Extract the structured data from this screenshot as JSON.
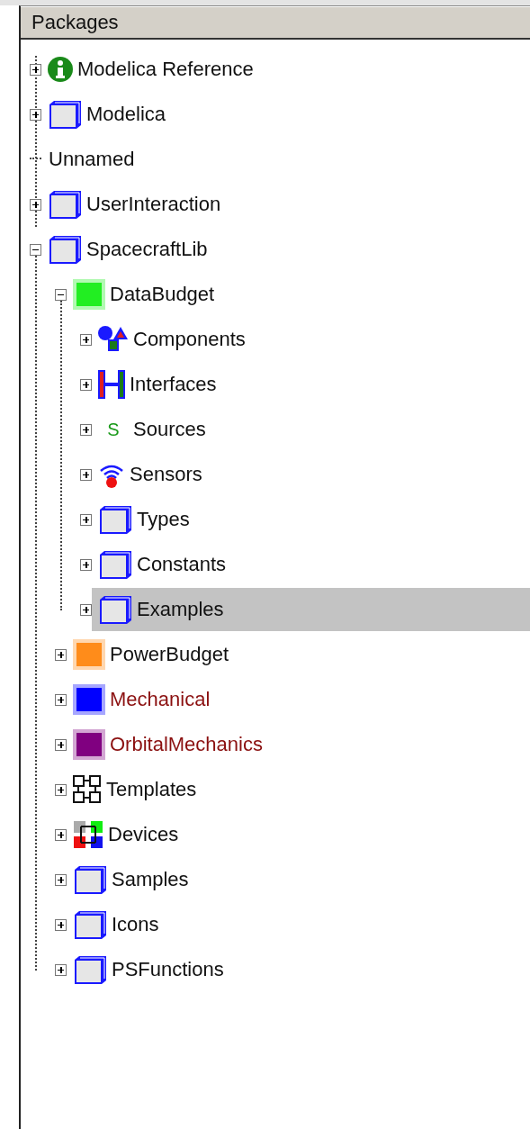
{
  "panel": {
    "title": "Packages"
  },
  "tree": [
    {
      "label": "Modelica Reference",
      "kind": "info",
      "expanded": false,
      "selected": false,
      "marked": false
    },
    {
      "label": "Modelica",
      "kind": "package",
      "expanded": false,
      "selected": false,
      "marked": false
    },
    {
      "label": "Unnamed",
      "kind": "none",
      "selected": false,
      "marked": false
    },
    {
      "label": "UserInteraction",
      "kind": "package",
      "expanded": false,
      "selected": false,
      "marked": false
    },
    {
      "label": "SpacecraftLib",
      "kind": "package",
      "expanded": true,
      "selected": false,
      "marked": false,
      "children": [
        {
          "label": "DataBudget",
          "kind": "square",
          "color": "#22ee22",
          "expanded": true,
          "selected": false,
          "marked": false,
          "children": [
            {
              "label": "Components",
              "kind": "components",
              "expanded": false,
              "selected": false,
              "marked": false
            },
            {
              "label": "Interfaces",
              "kind": "interfaces",
              "expanded": false,
              "selected": false,
              "marked": false
            },
            {
              "label": "Sources",
              "kind": "glyph",
              "glyph": "S",
              "expanded": false,
              "selected": false,
              "marked": false
            },
            {
              "label": "Sensors",
              "kind": "sensor",
              "expanded": false,
              "selected": false,
              "marked": false
            },
            {
              "label": "Types",
              "kind": "package",
              "expanded": false,
              "selected": false,
              "marked": false
            },
            {
              "label": "Constants",
              "kind": "package",
              "expanded": false,
              "selected": false,
              "marked": false
            },
            {
              "label": "Examples",
              "kind": "package",
              "expanded": false,
              "selected": true,
              "marked": false
            }
          ]
        },
        {
          "label": "PowerBudget",
          "kind": "square",
          "color": "#ff8c1a",
          "expanded": false,
          "selected": false,
          "marked": false
        },
        {
          "label": "Mechanical",
          "kind": "square",
          "color": "#0000ff",
          "expanded": false,
          "selected": false,
          "marked": true
        },
        {
          "label": "OrbitalMechanics",
          "kind": "square",
          "color": "#800080",
          "expanded": false,
          "selected": false,
          "marked": true
        },
        {
          "label": "Templates",
          "kind": "templates",
          "expanded": false,
          "selected": false,
          "marked": false
        },
        {
          "label": "Devices",
          "kind": "devices",
          "expanded": false,
          "selected": false,
          "marked": false
        },
        {
          "label": "Samples",
          "kind": "package",
          "expanded": false,
          "selected": false,
          "marked": false
        },
        {
          "label": "Icons",
          "kind": "package",
          "expanded": false,
          "selected": false,
          "marked": false
        },
        {
          "label": "PSFunctions",
          "kind": "package",
          "expanded": false,
          "selected": false,
          "marked": false
        }
      ]
    }
  ]
}
